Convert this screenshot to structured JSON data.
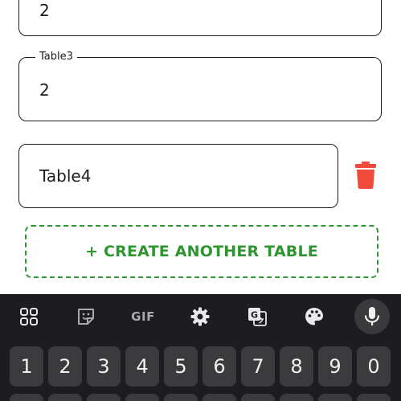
{
  "form": {
    "field1": {
      "value": "2"
    },
    "field2": {
      "label": "Table3",
      "value": "2"
    },
    "field3": {
      "value": "Table4"
    },
    "create_button_label": "+ CREATE ANOTHER TABLE"
  },
  "colors": {
    "accent_green": "#2e9630",
    "delete_red": "#f04a3a",
    "keyboard_bg": "#1d1d1f",
    "key_bg": "#3b3b3e"
  },
  "keyboard": {
    "toolbar": [
      {
        "icon": "apps-grid-icon"
      },
      {
        "icon": "sticker-icon"
      },
      {
        "icon": "gif-icon",
        "label": "GIF"
      },
      {
        "icon": "settings-icon"
      },
      {
        "icon": "translate-icon"
      },
      {
        "icon": "palette-icon"
      },
      {
        "icon": "microphone-icon"
      }
    ],
    "number_row": [
      "1",
      "2",
      "3",
      "4",
      "5",
      "6",
      "7",
      "8",
      "9",
      "0"
    ]
  }
}
